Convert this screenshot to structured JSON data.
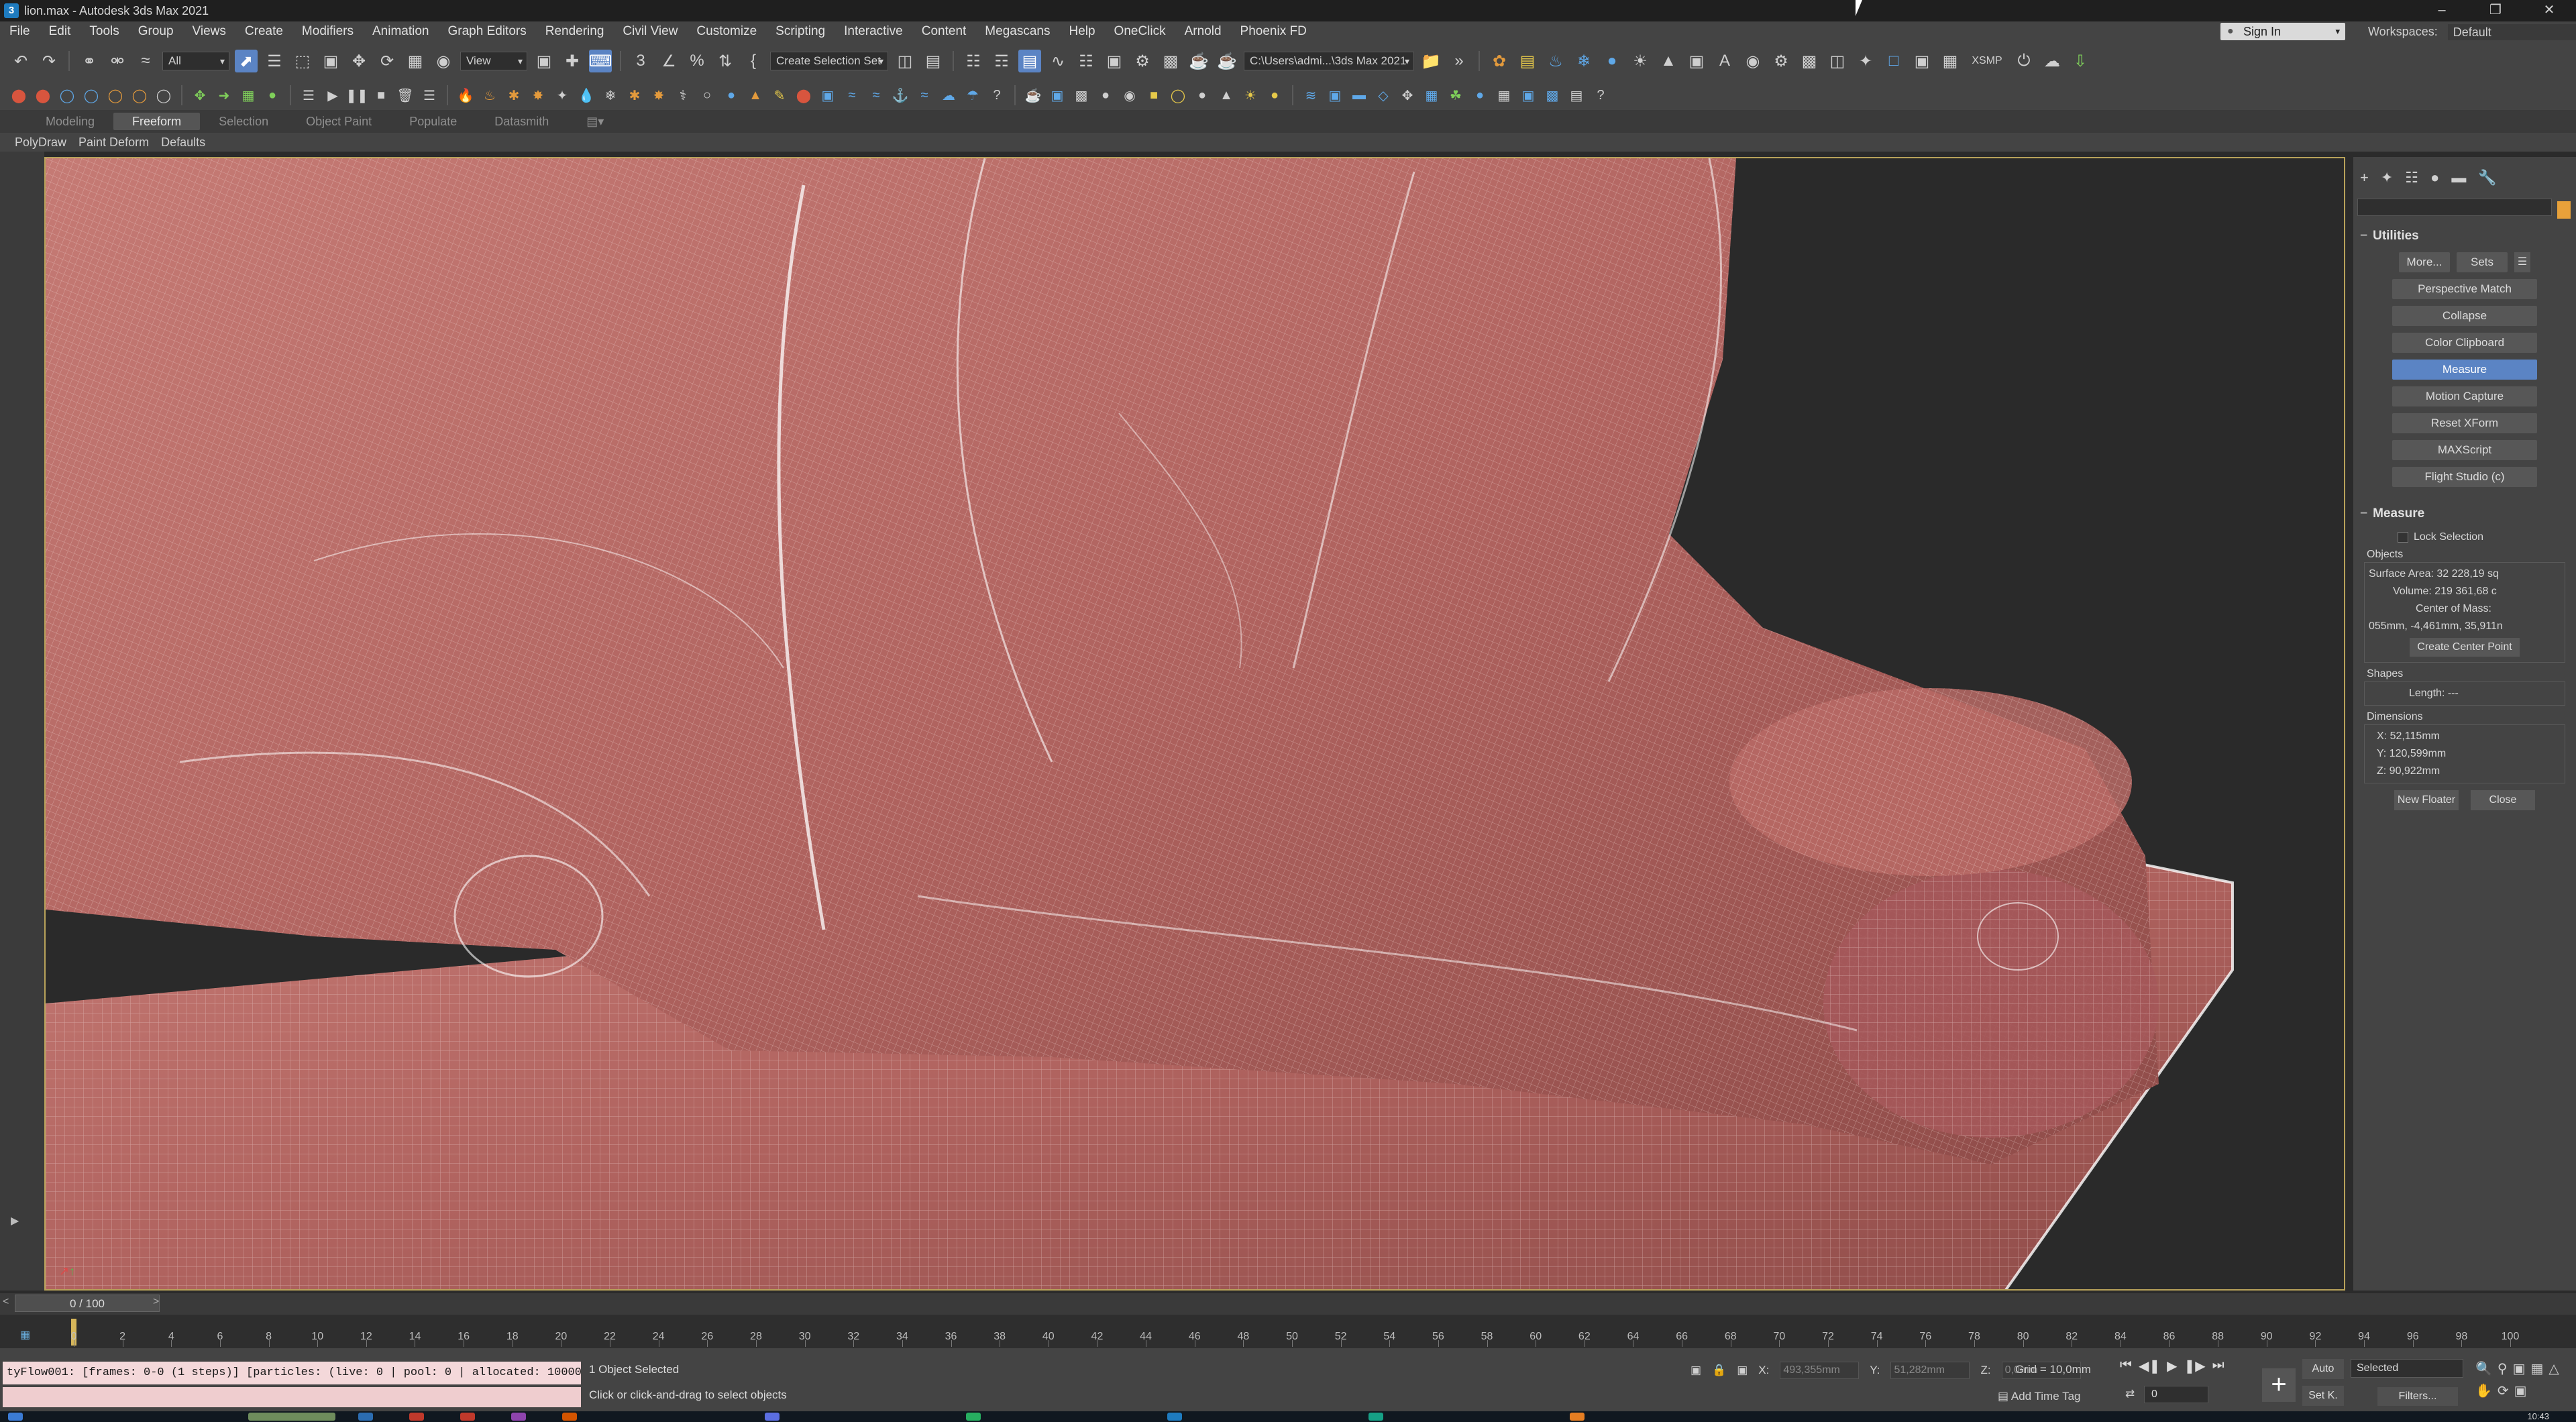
{
  "window": {
    "title": "lion.max - Autodesk 3ds Max 2021",
    "app_icon": "3",
    "controls": [
      "–",
      "❐",
      "✕"
    ]
  },
  "menu": [
    "File",
    "Edit",
    "Tools",
    "Group",
    "Views",
    "Create",
    "Modifiers",
    "Animation",
    "Graph Editors",
    "Rendering",
    "Civil View",
    "Customize",
    "Scripting",
    "Interactive",
    "Content",
    "Megascans",
    "Help",
    "OneClick",
    "Arnold",
    "Phoenix FD"
  ],
  "signin": "Sign In",
  "workspace": {
    "label": "Workspaces:",
    "value": "Default"
  },
  "toolbar": {
    "selection_filter": "All",
    "ref_coord": "View",
    "selection_set": "Create Selection Set",
    "project_path": "C:\\Users\\admi...\\3ds Max 2021",
    "xsmp": "XSMP"
  },
  "ribbon": {
    "tabs": [
      "Modeling",
      "Freeform",
      "Selection",
      "Object Paint",
      "Populate",
      "Datasmith"
    ],
    "active_tab": "Freeform",
    "sub_items": [
      "PolyDraw",
      "Paint Deform",
      "Defaults"
    ]
  },
  "command_panel": {
    "rollout_utilities": "Utilities",
    "more": "More...",
    "sets": "Sets",
    "utility_buttons": [
      "Perspective Match",
      "Collapse",
      "Color Clipboard",
      "Measure",
      "Motion Capture",
      "Reset XForm",
      "MAXScript",
      "Flight Studio (c)"
    ],
    "active_utility": "Measure",
    "rollout_measure": "Measure",
    "lock_selection": "Lock Selection",
    "objects_label": "Objects",
    "surface_area": "Surface Area: 32 228,19 sq",
    "volume": "Volume: 219 361,68 c",
    "center_of_mass_label": "Center of Mass:",
    "center_of_mass": "055mm, -4,461mm, 35,911n",
    "create_center_point": "Create Center Point",
    "shapes_label": "Shapes",
    "length": "Length: ---",
    "dimensions_label": "Dimensions",
    "dim_x": "X:  52,115mm",
    "dim_y": "Y:  120,599mm",
    "dim_z": "Z:  90,922mm",
    "new_floater": "New Floater",
    "close": "Close"
  },
  "timeline": {
    "slider_label": "0 / 100",
    "current_fraction": 0.0,
    "ticks": [
      "0",
      "2",
      "4",
      "6",
      "8",
      "10",
      "12",
      "14",
      "16",
      "18",
      "20",
      "22",
      "24",
      "26",
      "28",
      "30",
      "32",
      "34",
      "36",
      "38",
      "40",
      "42",
      "44",
      "46",
      "48",
      "50",
      "52",
      "54",
      "56",
      "58",
      "60",
      "62",
      "64",
      "66",
      "68",
      "70",
      "72",
      "74",
      "76",
      "78",
      "80",
      "82",
      "84",
      "86",
      "88",
      "90",
      "92",
      "94",
      "96",
      "98",
      "100"
    ]
  },
  "status": {
    "maxscript_output": "tyFlow001: [frames: 0-0 (1 steps)] [particles: (live: 0 | pool: 0 | allocated: 100000",
    "selection_info": "1 Object Selected",
    "prompt": "Click or click-and-drag to select objects",
    "x_label": "X:",
    "x_value": "493,355mm",
    "y_label": "Y:",
    "y_value": "51,282mm",
    "z_label": "Z:",
    "z_value": "0,0mm",
    "grid": "Grid = 10,0mm",
    "add_time_tag": "Add Time Tag",
    "frame": "0",
    "auto_key": "Auto",
    "set_key": "Set K.",
    "key_filter": "Selected",
    "filters": "Filters..."
  },
  "taskbar": {
    "clock": "10:43"
  },
  "colors": {
    "viewport_bg": "#2a2a2a",
    "mesh": "#b0635f",
    "accent": "#5b84c4",
    "viewport_border": "#b8a25a"
  }
}
